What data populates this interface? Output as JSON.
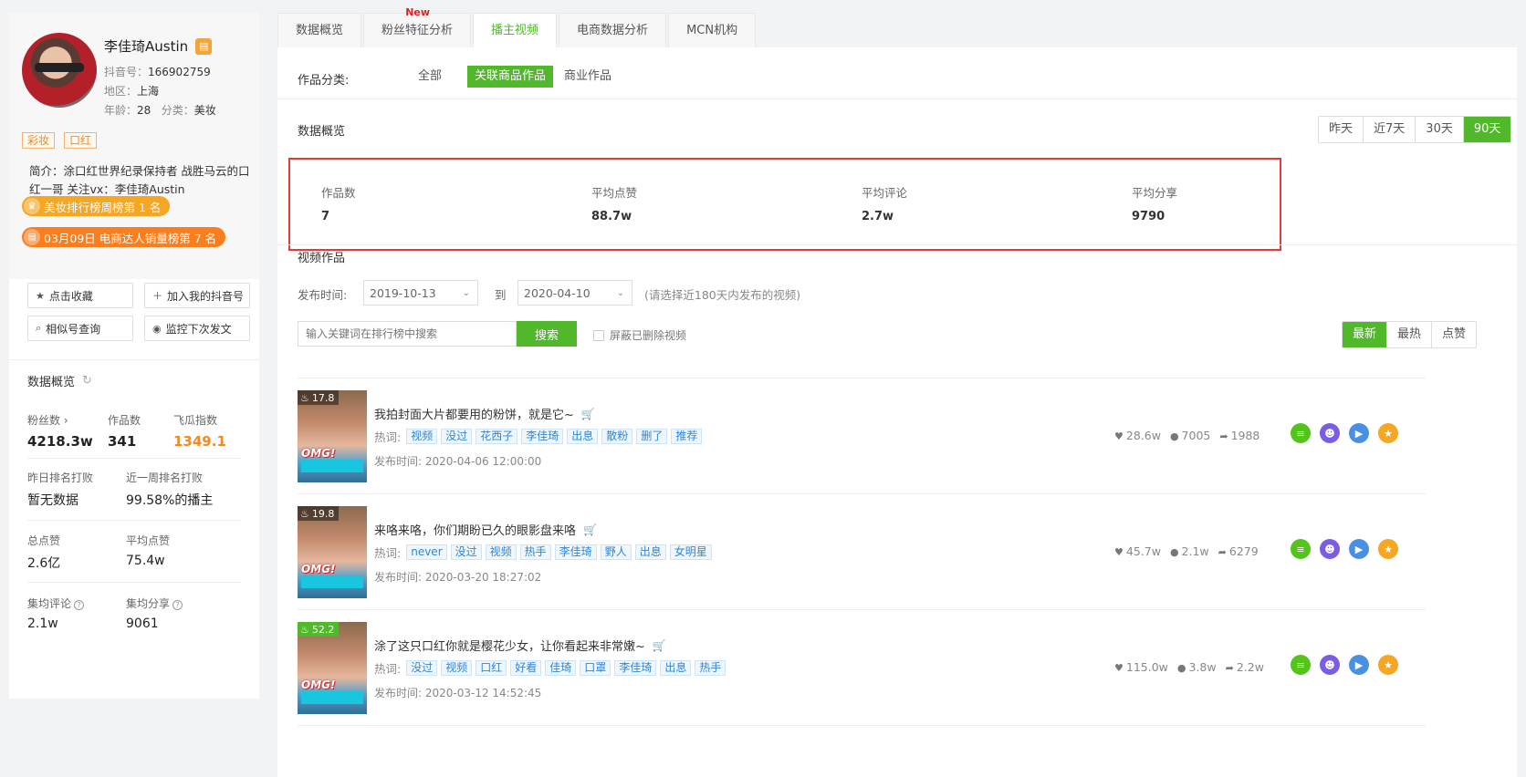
{
  "profile": {
    "name": "李佳琦Austin",
    "badge_icon": "store-badge-icon",
    "douyin_label": "抖音号：",
    "douyin_id": "166902759",
    "region_label": "地区：",
    "region": "上海",
    "age_label": "年龄：",
    "age": "28",
    "category_label": "分类：",
    "category": "美妆",
    "tags": [
      "彩妆",
      "口红"
    ],
    "intro": "简介：涂口红世界纪录保持者 战胜马云的口红一哥 关注vx：李佳琦Austin",
    "rank1": "美妆排行榜周榜第 1 名",
    "rank2": "03月09日 电商达人销量榜第 7 名",
    "rank1_color": "#f5a623",
    "rank2_color": "#fa7d1e"
  },
  "actions": {
    "favorite": "点击收藏",
    "add_mine": "加入我的抖音号",
    "similar": "相似号查询",
    "monitor": "监控下次发文"
  },
  "stats": {
    "title": "数据概览",
    "fans_label": "粉丝数",
    "fans": "4218.3w",
    "works_label": "作品数",
    "works": "341",
    "index_label": "飞瓜指数",
    "index": "1349.1",
    "yesterday_label": "昨日排名打败",
    "yesterday": "暂无数据",
    "week_label": "近一周排名打败",
    "week": "99.58%的播主",
    "total_likes_label": "总点赞",
    "total_likes": "2.6亿",
    "avg_likes_label": "平均点赞",
    "avg_likes": "75.4w",
    "avg_comment_label": "集均评论",
    "avg_comment": "2.1w",
    "avg_share_label": "集均分享",
    "avg_share": "9061"
  },
  "tabs": [
    {
      "label": "数据概览"
    },
    {
      "label": "粉丝特征分析",
      "badge": "New"
    },
    {
      "label": "播主视频"
    },
    {
      "label": "电商数据分析"
    },
    {
      "label": "MCN机构"
    }
  ],
  "category": {
    "label": "作品分类:",
    "options": [
      "全部",
      "关联商品作品",
      "商业作品"
    ],
    "selected": "关联商品作品"
  },
  "overview": {
    "title": "数据概览",
    "ranges": [
      "昨天",
      "近7天",
      "30天",
      "90天"
    ],
    "selected_range": "90天",
    "items": [
      {
        "label": "作品数",
        "value": "7"
      },
      {
        "label": "平均点赞",
        "value": "88.7w"
      },
      {
        "label": "平均评论",
        "value": "2.7w"
      },
      {
        "label": "平均分享",
        "value": "9790"
      }
    ]
  },
  "videos_section": {
    "title": "视频作品",
    "publish_label": "发布时间:",
    "date_from": "2019-10-13",
    "to_label": "到",
    "date_to": "2020-04-10",
    "hint": "(请选择近180天内发布的视频)",
    "search_placeholder": "输入关键词在排行榜中搜索",
    "search_button": "搜索",
    "hide_deleted": "屏蔽已删除视频",
    "sorts": [
      "最新",
      "最热",
      "点赞"
    ],
    "selected_sort": "最新",
    "hot_label": "热词:",
    "publish_prefix": "发布时间: "
  },
  "videos": [
    {
      "score": "17.8",
      "title": "我拍封面大片都要用的粉饼，就是它~",
      "keywords": [
        "视频",
        "没过",
        "花西子",
        "李佳琦",
        "出息",
        "散粉",
        "删了",
        "推荐"
      ],
      "published": "2020-04-06 12:00:00",
      "likes": "28.6w",
      "comments": "7005",
      "shares": "1988"
    },
    {
      "score": "19.8",
      "title": "来咯来咯，你们期盼已久的眼影盘来咯",
      "keywords": [
        "never",
        "没过",
        "视频",
        "热手",
        "李佳琦",
        "野人",
        "出息",
        "女明星"
      ],
      "published": "2020-03-20 18:27:02",
      "likes": "45.7w",
      "comments": "2.1w",
      "shares": "6279"
    },
    {
      "score": "52.2",
      "title": "涂了这只口红你就是樱花少女，让你看起来非常嫩~",
      "keywords": [
        "没过",
        "视频",
        "口红",
        "好看",
        "佳琦",
        "口罩",
        "李佳琦",
        "出息",
        "热手"
      ],
      "published": "2020-03-12 14:52:45",
      "likes": "115.0w",
      "comments": "3.8w",
      "shares": "2.2w"
    }
  ],
  "thumb_text": "OMG!",
  "colors": {
    "accent": "#50b82a",
    "orange": "#f08a24",
    "highlight_border": "#e53935",
    "act_green": "#52c41a",
    "act_purple": "#7b5ce6",
    "act_blue": "#4a90e2",
    "act_orange": "#f5a623"
  }
}
